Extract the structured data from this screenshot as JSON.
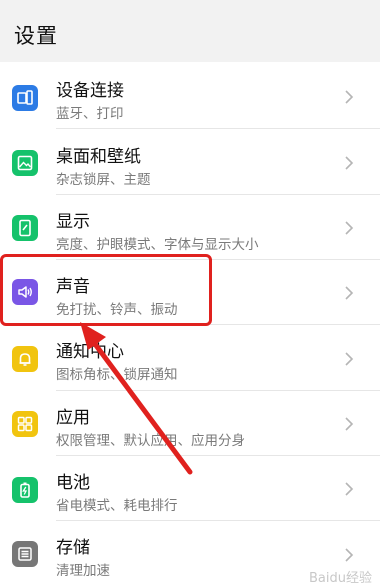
{
  "header": {
    "title": "设置"
  },
  "items": [
    {
      "title": "设备连接",
      "subtitle": "蓝牙、打印",
      "icon": "device-connect-icon",
      "color": "#2c7be5"
    },
    {
      "title": "桌面和壁纸",
      "subtitle": "杂志锁屏、主题",
      "icon": "wallpaper-icon",
      "color": "#15c26b"
    },
    {
      "title": "显示",
      "subtitle": "亮度、护眼模式、字体与显示大小",
      "icon": "display-icon",
      "color": "#15c26b"
    },
    {
      "title": "声音",
      "subtitle": "免打扰、铃声、振动",
      "icon": "sound-icon",
      "color": "#7a56e6"
    },
    {
      "title": "通知中心",
      "subtitle": "图标角标、锁屏通知",
      "icon": "notification-icon",
      "color": "#f1c40f"
    },
    {
      "title": "应用",
      "subtitle": "权限管理、默认应用、应用分身",
      "icon": "apps-icon",
      "color": "#f1c40f"
    },
    {
      "title": "电池",
      "subtitle": "省电模式、耗电排行",
      "icon": "battery-icon",
      "color": "#15c26b"
    },
    {
      "title": "存储",
      "subtitle": "清理加速",
      "icon": "storage-icon",
      "color": "#777777"
    }
  ],
  "watermark": "Baidu经验"
}
